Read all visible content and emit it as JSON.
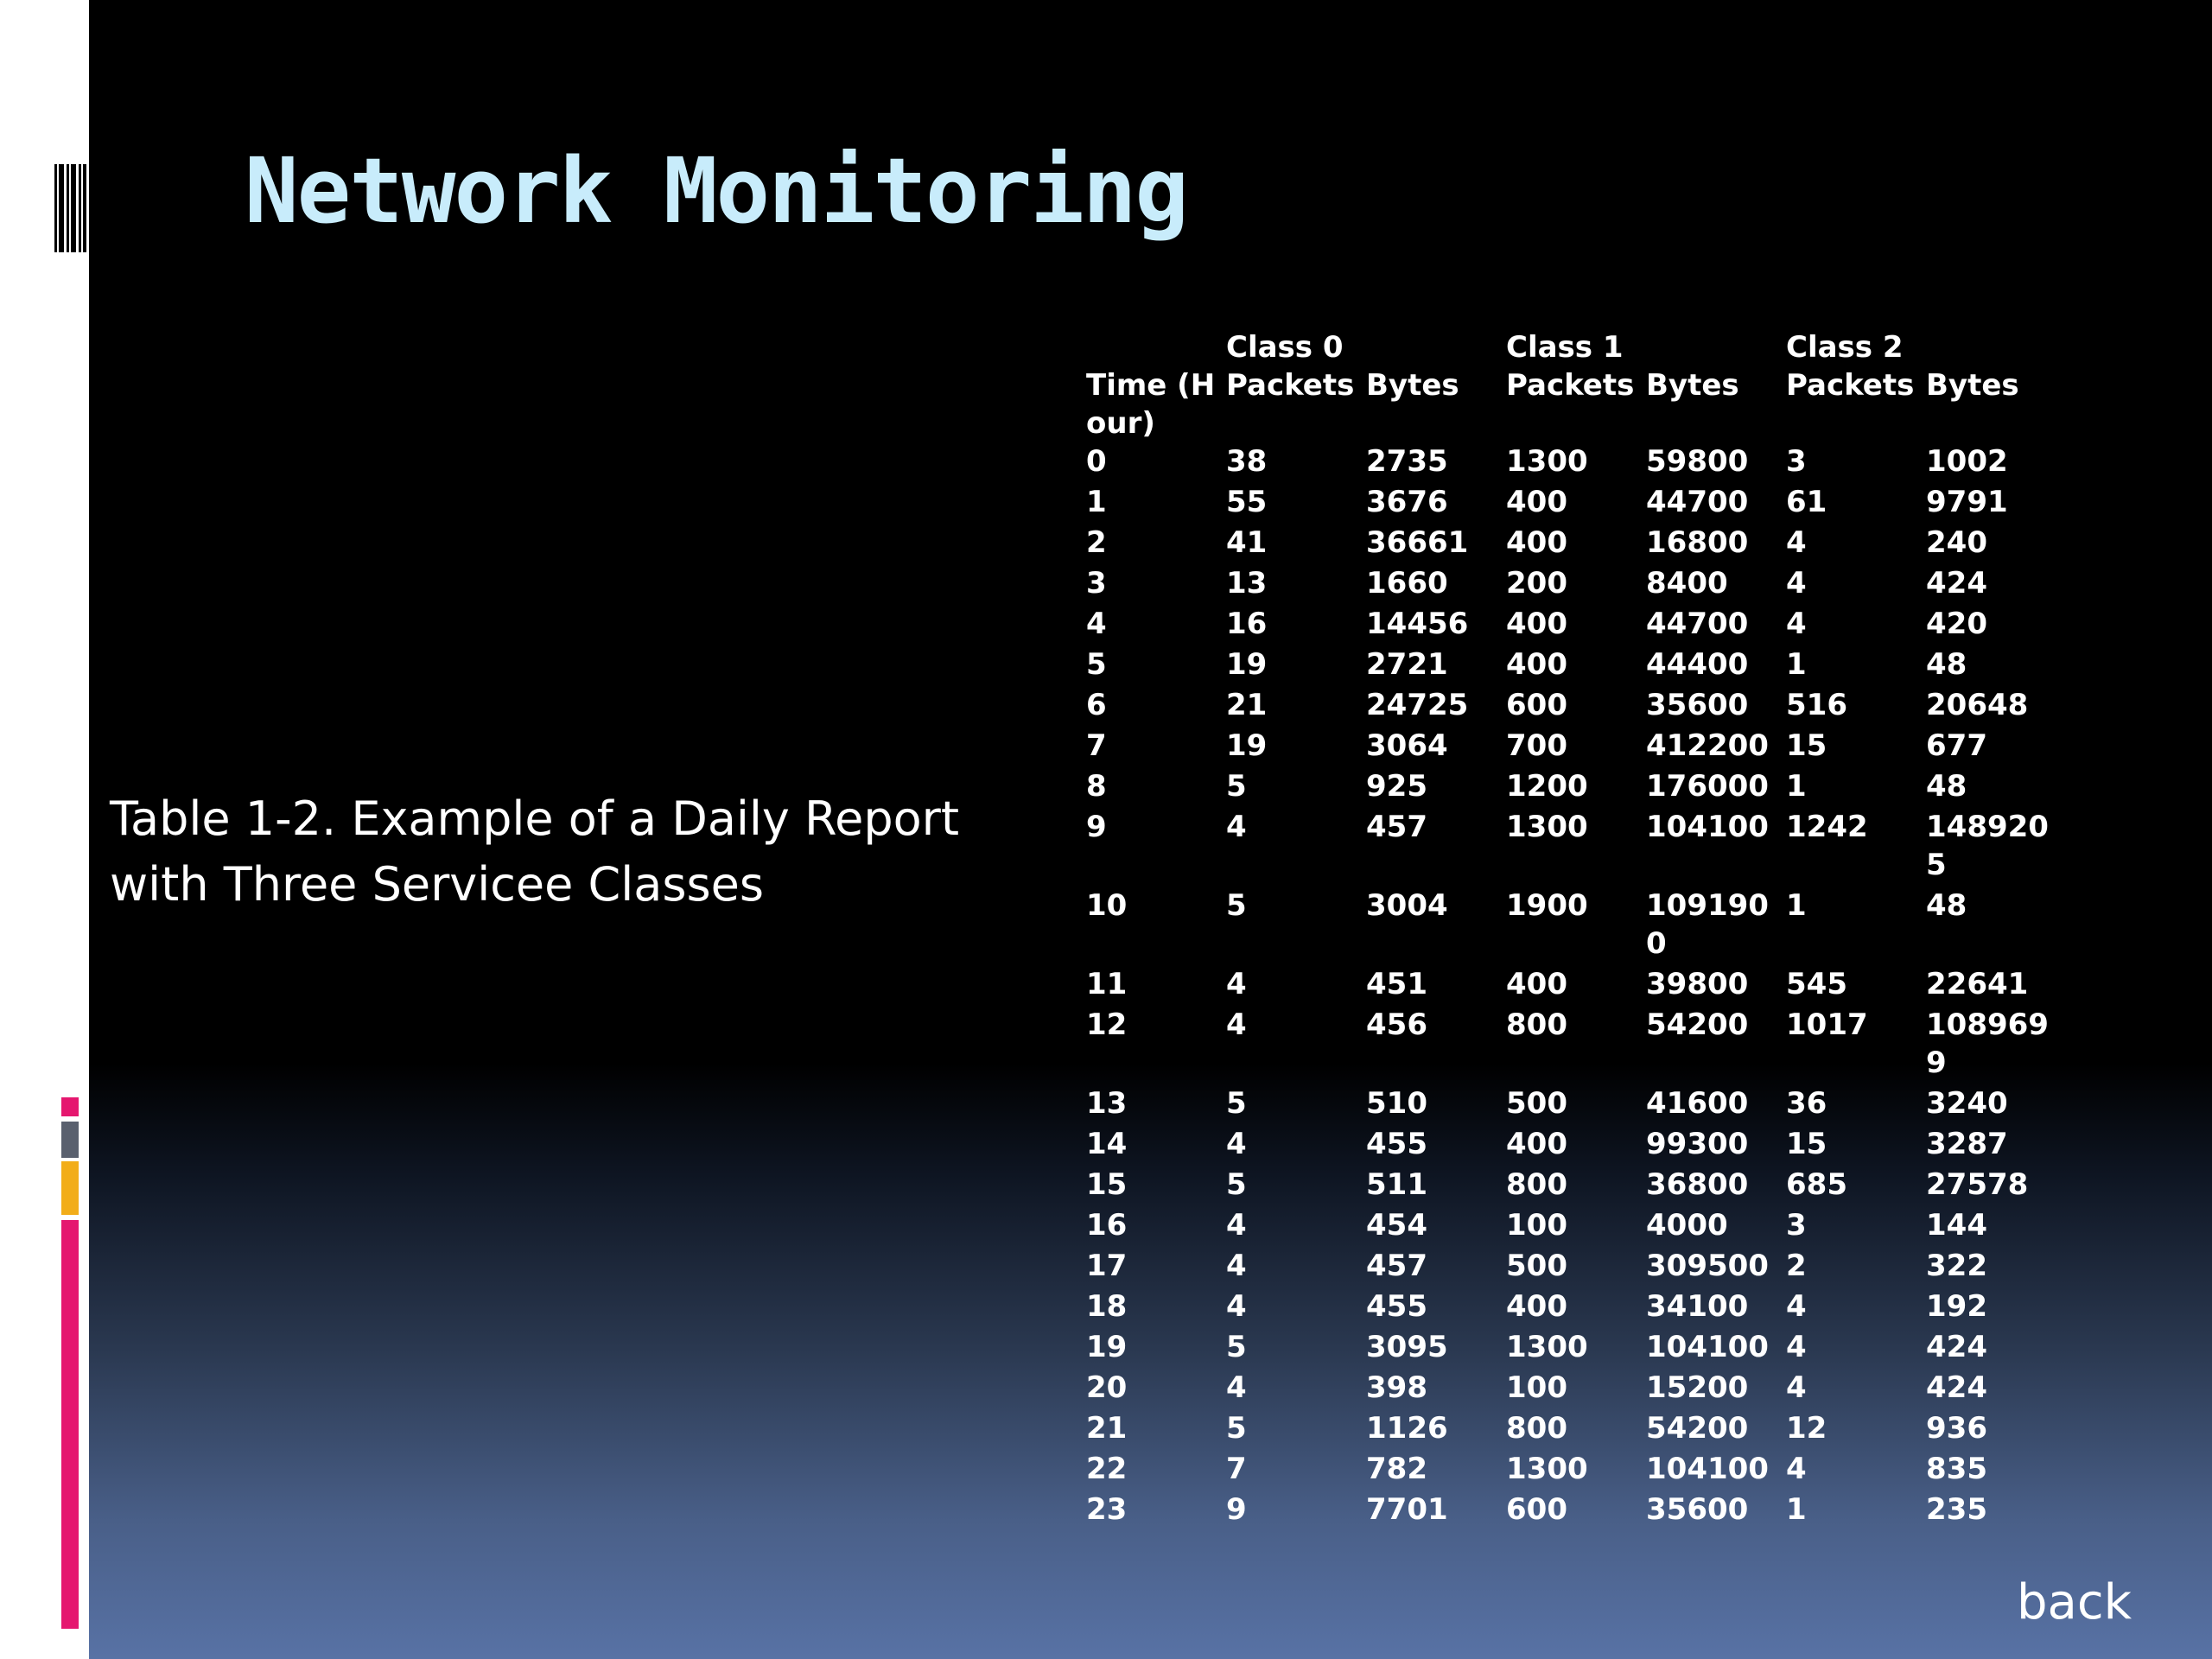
{
  "slide": {
    "title": "Network Monitoring",
    "caption": "Table 1-2. Example of a Daily Report with Three Servicee Classes",
    "back_label": "back"
  },
  "colors": {
    "title": "#c8ecfb",
    "accent_magenta": "#e5176f",
    "accent_orange": "#f2ad19",
    "accent_gray": "#59606e"
  },
  "table": {
    "group_headers": [
      "",
      "Class 0",
      "",
      "Class 1",
      "",
      "Class 2",
      ""
    ],
    "column_headers": [
      "Time (Hour)",
      "Packets",
      "Bytes",
      "Packets",
      "Bytes",
      "Packets",
      "Bytes"
    ],
    "rows": [
      [
        "0",
        "38",
        "2735",
        "1300",
        "59800",
        "3",
        "1002"
      ],
      [
        "1",
        "55",
        "3676",
        "400",
        "44700",
        "61",
        "9791"
      ],
      [
        "2",
        "41",
        "36661",
        "400",
        "16800",
        "4",
        "240"
      ],
      [
        "3",
        "13",
        "1660",
        "200",
        "8400",
        "4",
        "424"
      ],
      [
        "4",
        "16",
        "14456",
        "400",
        "44700",
        "4",
        "420"
      ],
      [
        "5",
        "19",
        "2721",
        "400",
        "44400",
        "1",
        "48"
      ],
      [
        "6",
        "21",
        "24725",
        "600",
        "35600",
        "516",
        "20648"
      ],
      [
        "7",
        "19",
        "3064",
        "700",
        "412200",
        "15",
        "677"
      ],
      [
        "8",
        "5",
        "925",
        "1200",
        "176000",
        "1",
        "48"
      ],
      [
        "9",
        "4",
        "457",
        "1300",
        "104100",
        "1242",
        "1489205"
      ],
      [
        "10",
        "5",
        "3004",
        "1900",
        "1091900",
        "1",
        "48"
      ],
      [
        "11",
        "4",
        "451",
        "400",
        "39800",
        "545",
        "22641"
      ],
      [
        "12",
        "4",
        "456",
        "800",
        "54200",
        "1017",
        "1089699"
      ],
      [
        "13",
        "5",
        "510",
        "500",
        "41600",
        "36",
        "3240"
      ],
      [
        "14",
        "4",
        "455",
        "400",
        "99300",
        "15",
        "3287"
      ],
      [
        "15",
        "5",
        "511",
        "800",
        "36800",
        "685",
        "27578"
      ],
      [
        "16",
        "4",
        "454",
        "100",
        "4000",
        "3",
        "144"
      ],
      [
        "17",
        "4",
        "457",
        "500",
        "309500",
        "2",
        "322"
      ],
      [
        "18",
        "4",
        "455",
        "400",
        "34100",
        "4",
        "192"
      ],
      [
        "19",
        "5",
        "3095",
        "1300",
        "104100",
        "4",
        "424"
      ],
      [
        "20",
        "4",
        "398",
        "100",
        "15200",
        "4",
        "424"
      ],
      [
        "21",
        "5",
        "1126",
        "800",
        "54200",
        "12",
        "936"
      ],
      [
        "22",
        "7",
        "782",
        "1300",
        "104100",
        "4",
        "835"
      ],
      [
        "23",
        "9",
        "7701",
        "600",
        "35600",
        "1",
        "235"
      ]
    ]
  }
}
